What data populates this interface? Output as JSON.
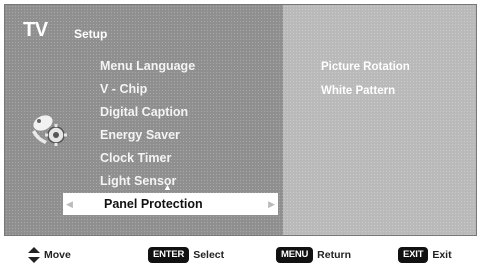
{
  "header": {
    "device": "TV",
    "section": "Setup"
  },
  "menu": {
    "items": [
      {
        "label": "Menu Language"
      },
      {
        "label": "V - Chip"
      },
      {
        "label": "Digital Caption"
      },
      {
        "label": "Energy Saver"
      },
      {
        "label": "Clock Timer"
      },
      {
        "label": "Light Sensor"
      }
    ],
    "selected": {
      "label": "Panel Protection"
    }
  },
  "submenu": {
    "items": [
      {
        "label": "Picture Rotation"
      },
      {
        "label": "White Pattern"
      }
    ]
  },
  "footer": {
    "move": {
      "text": "Move",
      "icon": "up-down-arrow-icon"
    },
    "select": {
      "key": "ENTER",
      "text": "Select"
    },
    "return": {
      "key": "MENU",
      "text": "Return"
    },
    "exit": {
      "key": "EXIT",
      "text": "Exit"
    }
  },
  "colors": {
    "panel": "#8f8f8f",
    "right_panel": "#b9b9b9",
    "highlight": "#ffffff",
    "key_bg": "#111111"
  }
}
